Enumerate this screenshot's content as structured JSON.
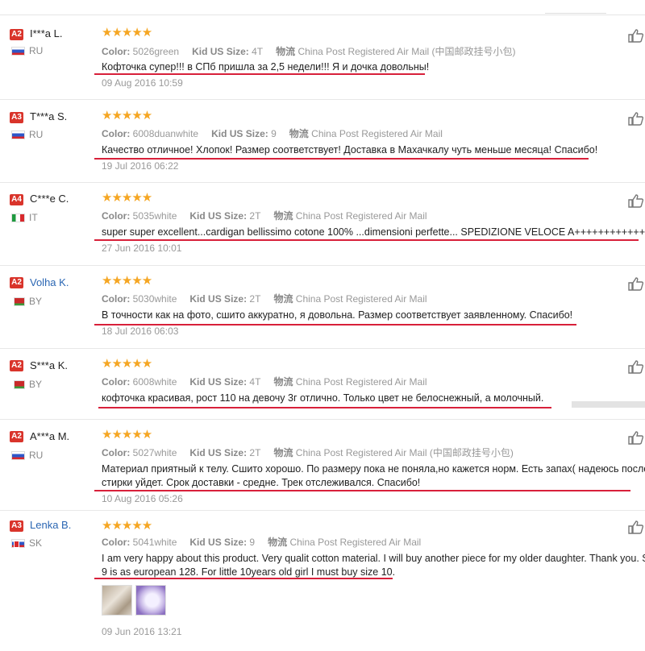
{
  "labels": {
    "color": "Color:",
    "size": "Kid US Size:",
    "shipping": "物流"
  },
  "stars": "★★★★★",
  "thumb_icon": "thumbs-up-icon",
  "reviews": [
    {
      "badge": "A2",
      "name": "I***a L.",
      "country": "RU",
      "color": "5026green",
      "size": "4T",
      "shipping": "China Post Registered Air Mail (中国邮政挂号小包)",
      "text": [
        "Кофточка супер!!! в СПб пришла за 2,5 недели!!! Я и дочка довольны!"
      ],
      "date": "09 Aug 2016 10:59"
    },
    {
      "badge": "A3",
      "name": "T***a S.",
      "country": "RU",
      "color": "6008duanwhite",
      "size": "9",
      "shipping": "China Post Registered Air Mail",
      "text": [
        "Качество отличное! Хлопок! Размер соответствует! Доставка в Махачкалу чуть меньше месяца! Спасибо!"
      ],
      "date": "19 Jul 2016 06:22"
    },
    {
      "badge": "A4",
      "name": "C***e C.",
      "country": "IT",
      "color": "5035white",
      "size": "2T",
      "shipping": "China Post Registered Air Mail",
      "text": [
        "super super excellent...cardigan bellissimo cotone 100% ...dimensioni perfette... SPEDIZIONE VELOCE A++++++++++++++++"
      ],
      "date": "27 Jun 2016 10:01"
    },
    {
      "badge": "A2",
      "name": "Volha K.",
      "country": "BY",
      "color": "5030white",
      "size": "2T",
      "shipping": "China Post Registered Air Mail",
      "text": [
        "В точности как на фото, сшито аккуратно, я довольна. Размер соответствует заявленному. Спасибо!"
      ],
      "date": "18 Jul 2016 06:03"
    },
    {
      "badge": "A2",
      "name": "S***a K.",
      "country": "BY",
      "color": "6008white",
      "size": "4T",
      "shipping": "China Post Registered Air Mail",
      "text": [
        "кофточка красивая, рост 110 на девочу 3г отлично. Только цвет не белоснежный, а молочный."
      ],
      "date": ""
    },
    {
      "badge": "A2",
      "name": "A***a M.",
      "country": "RU",
      "color": "5027white",
      "size": "2T",
      "shipping": "China Post Registered Air Mail (中国邮政挂号小包)",
      "text": [
        "Материал приятный к телу. Сшито хорошо. По размеру пока не поняла,но кажется норм. Есть запах( надеюсь после",
        "стирки уйдет. Срок доставки - средне. Трек отслеживался. Спасибо!"
      ],
      "date": "10 Aug 2016 05:26"
    },
    {
      "badge": "A3",
      "name": "Lenka B.",
      "country": "SK",
      "color": "5041white",
      "size": "9",
      "shipping": "China Post Registered Air Mail",
      "text": [
        "I am very happy about this product. Very qualit cotton material. I will buy another piece for my older daughter. Thank you. S",
        "9 is as european 128. For little 10years old girl I must buy size 10."
      ],
      "date": "09 Jun 2016 13:21"
    }
  ]
}
